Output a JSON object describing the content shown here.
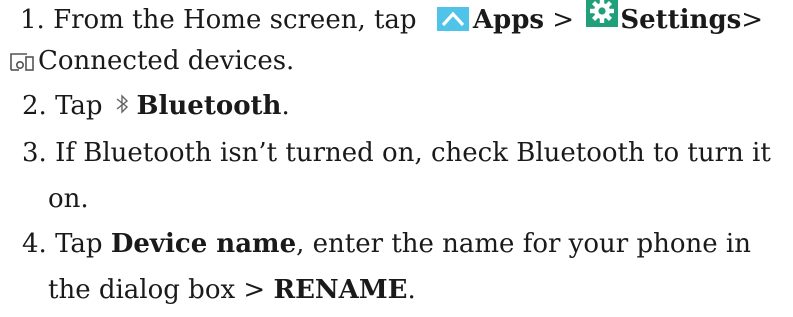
{
  "steps": {
    "s1": {
      "number": "1.",
      "text_a": "From the Home screen, tap",
      "apps": "Apps",
      "sep1": ">",
      "settings": "Settings",
      "sep2": ">",
      "cont": "Connected devices."
    },
    "s2": {
      "number": "2.",
      "text_a": "Tap",
      "bluetooth": "Bluetooth",
      "period": "."
    },
    "s3": {
      "number": "3.",
      "text_a": "If Bluetooth isn’t turned on, check Bluetooth to turn it",
      "cont": "on."
    },
    "s4": {
      "number": "4.",
      "text_a": "Tap",
      "device_name": "Device name",
      "text_b": ", enter the name for your phone in",
      "cont_a": "the dialog box >",
      "rename": "RENAME",
      "period": "."
    }
  },
  "icons": {
    "apps": "apps-chevron-icon",
    "settings": "settings-gear-icon",
    "devices": "connected-devices-icon",
    "bluetooth": "bluetooth-icon"
  },
  "colors": {
    "apps_icon_bg": "#4fc3e8",
    "settings_icon_bg": "#1f9f7a"
  }
}
